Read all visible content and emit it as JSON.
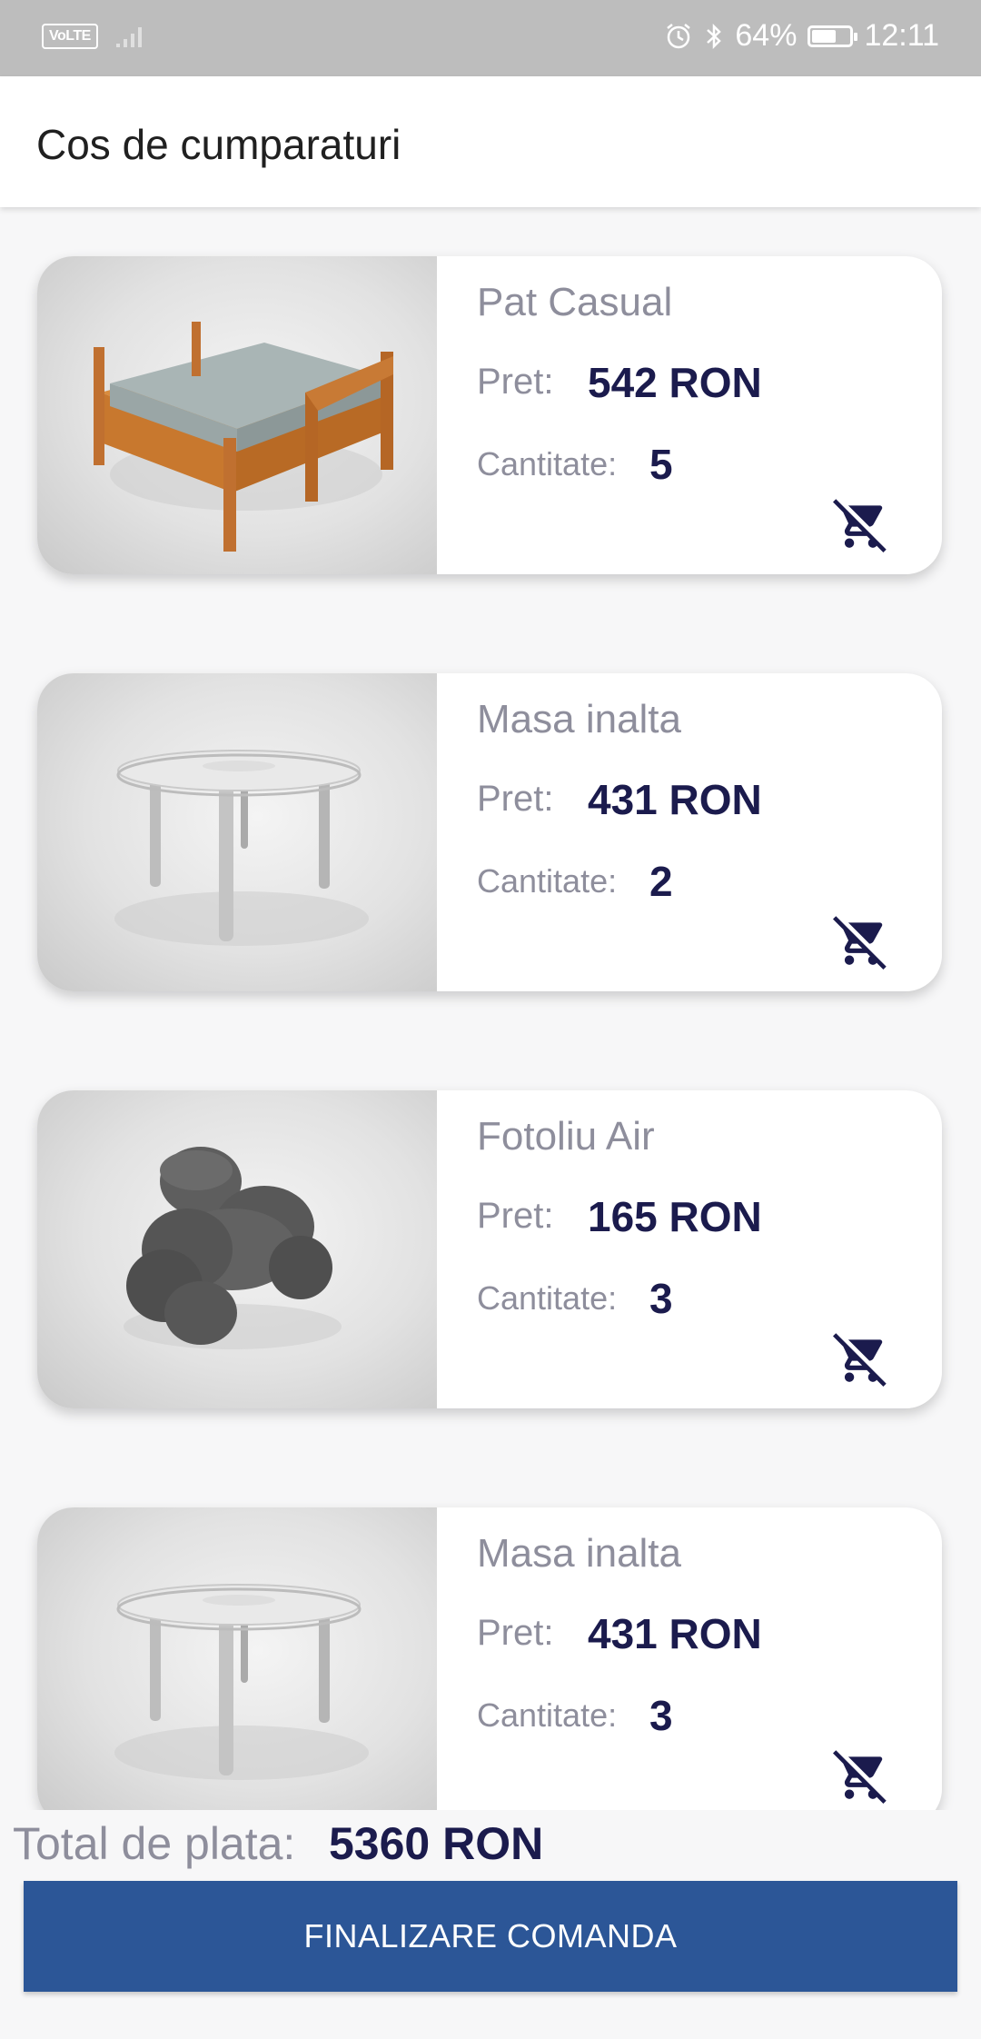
{
  "status_bar": {
    "volte": "VoLTE",
    "battery_text": "64%",
    "battery_level": 0.64,
    "time": "12:11"
  },
  "app_bar": {
    "title": "Cos de cumparaturi"
  },
  "cart": {
    "price_label": "Pret:",
    "quantity_label": "Cantitate:",
    "items": [
      {
        "name": "Pat Casual",
        "price": "542 RON",
        "quantity": "5",
        "image": "bed-image"
      },
      {
        "name": "Masa inalta",
        "price": "431 RON",
        "quantity": "2",
        "image": "table-image"
      },
      {
        "name": "Fotoliu Air",
        "price": "165 RON",
        "quantity": "3",
        "image": "armchair-image"
      },
      {
        "name": "Masa inalta",
        "price": "431 RON",
        "quantity": "3",
        "image": "table-image"
      }
    ]
  },
  "footer": {
    "total_label": "Total de plata:",
    "total_value": "5360 RON",
    "checkout_button": "FINALIZARE COMANDA"
  },
  "colors": {
    "accent": "#2c5697",
    "text_dark": "#1b1b4d",
    "text_muted": "#8e8e9c"
  }
}
